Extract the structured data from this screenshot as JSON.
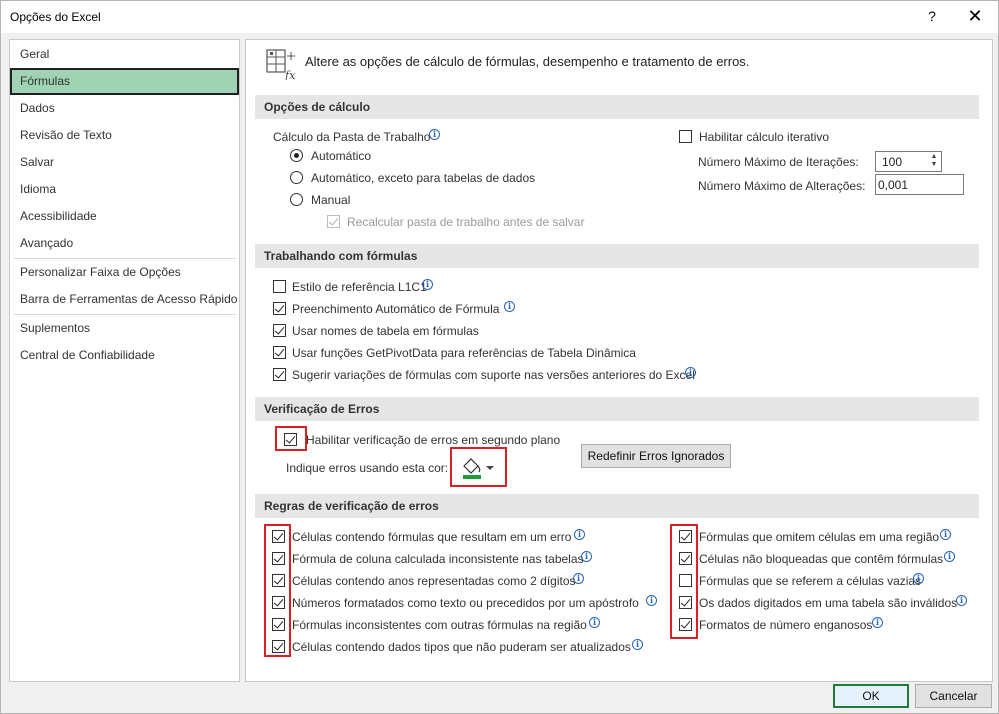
{
  "window": {
    "title": "Opções do Excel",
    "help": "?",
    "close": "✕"
  },
  "sidebar": {
    "items": [
      "Geral",
      "Fórmulas",
      "Dados",
      "Revisão de Texto",
      "Salvar",
      "Idioma",
      "Acessibilidade",
      "Avançado",
      "Personalizar Faixa de Opções",
      "Barra de Ferramentas de Acesso Rápido",
      "Suplementos",
      "Central de Confiabilidade"
    ],
    "active": "Fórmulas"
  },
  "header": {
    "text": "Altere as opções de cálculo de fórmulas, desempenho e tratamento de erros."
  },
  "calc": {
    "section_title": "Opções de cálculo",
    "workbook_label": "Cálculo da Pasta de Trabalho",
    "radio_auto": "Automático",
    "radio_auto_except": "Automático, exceto para tabelas de dados",
    "radio_manual": "Manual",
    "recalc": "Recalcular pasta de trabalho antes de salvar",
    "iterative": "Habilitar cálculo iterativo",
    "max_iter_label": "Número Máximo de Iterações:",
    "max_iter_value": "100",
    "max_change_label": "Número Máximo de Alterações:",
    "max_change_value": "0,001"
  },
  "formulas": {
    "section_title": "Trabalhando com fórmulas",
    "r1c1": "Estilo de referência L1C1",
    "autocomplete": "Preenchimento Automático de Fórmula",
    "table_names": "Usar nomes de tabela em fórmulas",
    "getpivot": "Usar funções GetPivotData para referências de Tabela Dinâmica",
    "suggest": "Sugerir variações de fórmulas com suporte nas versões anteriores do Excel"
  },
  "errors": {
    "section_title": "Verificação de Erros",
    "background": "Habilitar verificação de erros em segundo plano",
    "color_label": "Indique erros usando esta cor:",
    "reset_button": "Redefinir Erros Ignorados",
    "indicator_color": "#1e9c3c"
  },
  "rules": {
    "section_title": "Regras de verificação de erros",
    "left": [
      "Células contendo fórmulas que resultam em um erro",
      "Fórmula de coluna calculada inconsistente nas tabelas",
      "Células contendo anos representadas como 2 dígitos",
      "Números formatados como texto ou precedidos por um apóstrofo",
      "Fórmulas inconsistentes com outras fórmulas na região",
      "Células contendo dados tipos que não puderam ser atualizados"
    ],
    "right": [
      "Fórmulas que omitem células em uma região",
      "Células não bloqueadas que contêm fórmulas",
      "Fórmulas que se referem a células vazias",
      "Os dados digitados em uma tabela são inválidos",
      "Formatos de número enganosos"
    ]
  },
  "footer": {
    "ok": "OK",
    "cancel": "Cancelar"
  },
  "colors": {
    "active_nav": "#a0d2b4",
    "highlight": "#d92027",
    "ok_border": "#1f7a3f"
  }
}
